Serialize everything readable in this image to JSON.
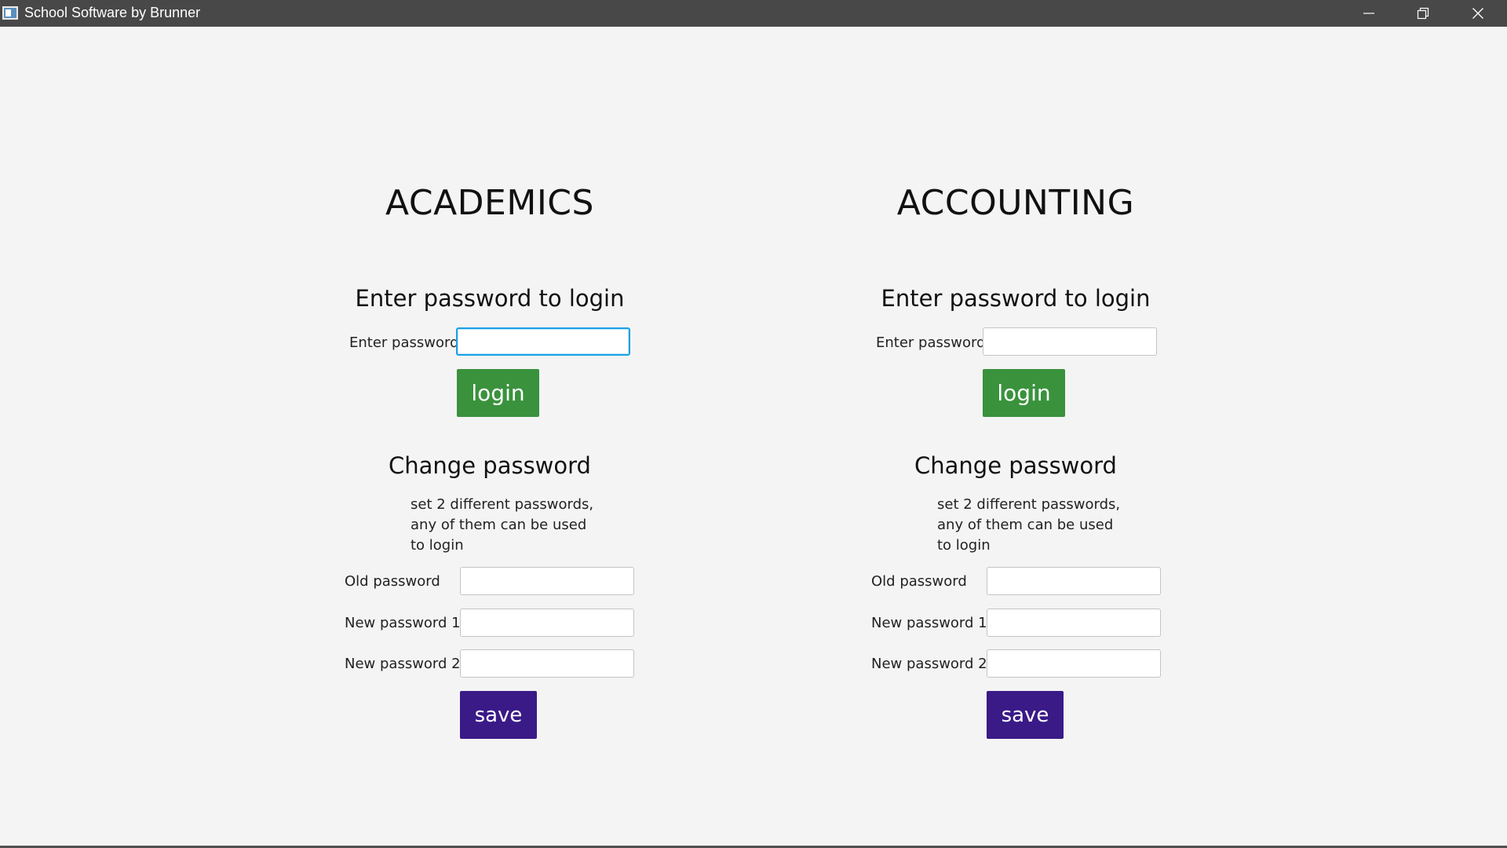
{
  "window": {
    "title": "School Software by Brunner",
    "icon": "app-window-icon",
    "controls": [
      "minimize-icon",
      "restore-icon",
      "close-icon"
    ]
  },
  "academics": {
    "title": "ACADEMICS",
    "login_heading": "Enter password to login",
    "password_label": "Enter password",
    "password_value": "",
    "login_label": "login",
    "change_heading": "Change password",
    "help_lines": [
      "set 2 different passwords,",
      "any of them can be used",
      "to login"
    ],
    "old_label": "Old password",
    "new1_label": "New password 1",
    "new2_label": "New password 2",
    "save_label": "save"
  },
  "accounting": {
    "title": "ACCOUNTING",
    "login_heading": "Enter password to login",
    "password_label": "Enter password",
    "password_value": "",
    "login_label": "login",
    "change_heading": "Change password",
    "help_lines": [
      "set 2 different passwords,",
      "any of them can be used",
      "to login"
    ],
    "old_label": "Old password",
    "new1_label": "New password 1",
    "new2_label": "New password 2",
    "save_label": "save"
  },
  "colors": {
    "login_button": "#3a923d",
    "save_button": "#3a1a87",
    "title_bar": "#484848",
    "focus_border": "#1aa0e6",
    "background": "#f4f4f4"
  }
}
